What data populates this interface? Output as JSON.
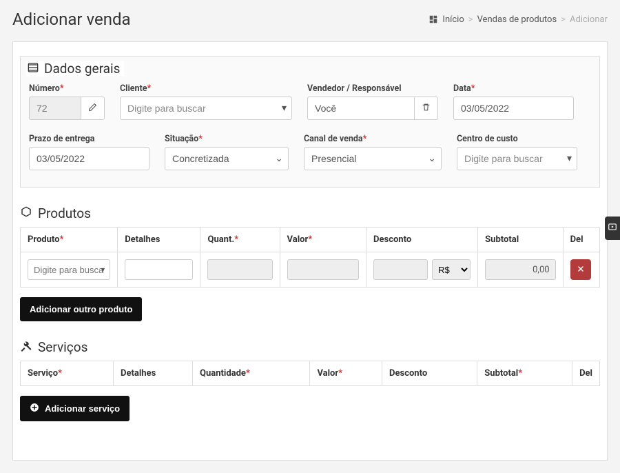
{
  "page": {
    "title": "Adicionar venda"
  },
  "breadcrumb": {
    "home": "Início",
    "sales": "Vendas de produtos",
    "current": "Adicionar"
  },
  "sections": {
    "general": "Dados gerais",
    "products": "Produtos",
    "services": "Serviços"
  },
  "general": {
    "numero_label": "Número",
    "numero_value": "72",
    "cliente_label": "Cliente",
    "cliente_placeholder": "Digite para buscar",
    "vendedor_label": "Vendedor / Responsável",
    "vendedor_value": "Você",
    "data_label": "Data",
    "data_value": "03/05/2022",
    "prazo_label": "Prazo de entrega",
    "prazo_value": "03/05/2022",
    "situacao_label": "Situação",
    "situacao_value": "Concretizada",
    "canal_label": "Canal de venda",
    "canal_value": "Presencial",
    "cc_label": "Centro de custo",
    "cc_placeholder": "Digite para buscar"
  },
  "products": {
    "headers": {
      "produto": "Produto",
      "detalhes": "Detalhes",
      "quant": "Quant.",
      "valor": "Valor",
      "desconto": "Desconto",
      "subtotal": "Subtotal",
      "del": "Del"
    },
    "row": {
      "produto_placeholder": "Digite para busca",
      "desconto_unit": "R$",
      "subtotal": "0,00"
    },
    "add_button": "Adicionar outro produto"
  },
  "services": {
    "headers": {
      "servico": "Serviço",
      "detalhes": "Detalhes",
      "quantidade": "Quantidade",
      "valor": "Valor",
      "desconto": "Desconto",
      "subtotal": "Subtotal",
      "del": "Del"
    },
    "add_button": "Adicionar serviço"
  }
}
